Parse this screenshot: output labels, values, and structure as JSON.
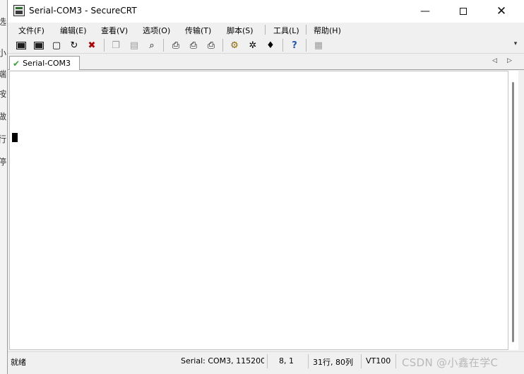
{
  "background_window": {
    "glyphs": [
      "选",
      "小",
      "端",
      "按",
      "做",
      "行",
      "停"
    ]
  },
  "window": {
    "title": "Serial-COM3 - SecureCRT",
    "minimize_glyph": "—",
    "close_glyph": "✕"
  },
  "menu": [
    {
      "label": "文件(F)",
      "name": "menu-file"
    },
    {
      "label": "编辑(E)",
      "name": "menu-edit"
    },
    {
      "label": "查看(V)",
      "name": "menu-view"
    },
    {
      "label": "选项(O)",
      "name": "menu-options"
    },
    {
      "label": "传输(T)",
      "name": "menu-transfer"
    },
    {
      "label": "脚本(S)",
      "name": "menu-script"
    },
    {
      "label": "工具(L)",
      "name": "menu-tools"
    },
    {
      "label": "帮助(H)",
      "name": "menu-help"
    }
  ],
  "toolbar": {
    "items": [
      {
        "icon": "connect-icon",
        "glyph": "▣"
      },
      {
        "icon": "quick-connect-icon",
        "glyph": "▣"
      },
      {
        "icon": "connect-in-tab-icon",
        "glyph": "▢"
      },
      {
        "icon": "reconnect-icon",
        "glyph": "↻"
      },
      {
        "icon": "disconnect-icon",
        "glyph": "✖"
      },
      {
        "icon": "copy-icon",
        "glyph": "❐",
        "disabled": true
      },
      {
        "icon": "paste-icon",
        "glyph": "▤",
        "disabled": true
      },
      {
        "icon": "find-icon",
        "glyph": "⌕"
      },
      {
        "icon": "print-icon",
        "glyph": "⎙"
      },
      {
        "icon": "print-selection-icon",
        "glyph": "⎙"
      },
      {
        "icon": "print-setup-icon",
        "glyph": "⎙"
      },
      {
        "icon": "session-options-icon",
        "glyph": "⚙"
      },
      {
        "icon": "global-options-icon",
        "glyph": "✲"
      },
      {
        "icon": "keymap-icon",
        "glyph": "♦"
      },
      {
        "icon": "help-icon",
        "glyph": "?"
      },
      {
        "icon": "about-icon",
        "glyph": "▦",
        "disabled": true
      }
    ],
    "overflow_glyph": "▾"
  },
  "tabs": {
    "active": {
      "label": "Serial-COM3",
      "icon": "connected-check-icon",
      "glyph": "✔"
    },
    "nav_left": "◁",
    "nav_right": "▷"
  },
  "status": {
    "state": "就绪",
    "connection": "Serial: COM3, 115200",
    "cursor_pos": "8,  1",
    "dimensions": "31行, 80列",
    "emulation": "VT100",
    "watermark": "CSDN @小鑫在学C"
  }
}
